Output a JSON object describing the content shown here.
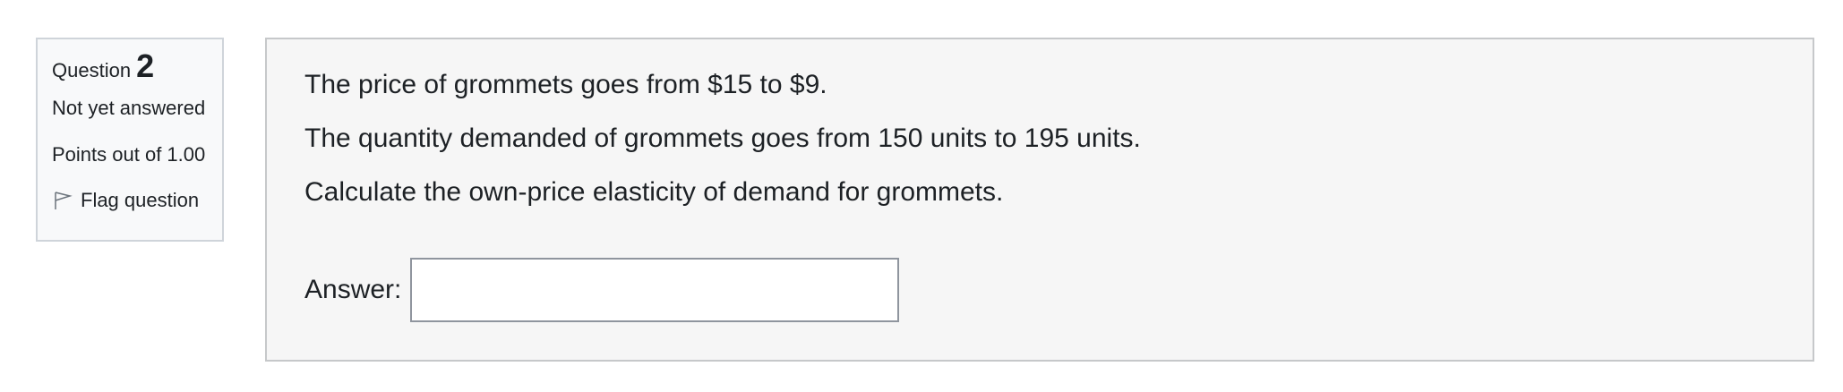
{
  "question_info": {
    "question_label": "Question",
    "question_number": "2",
    "state": "Not yet answered",
    "grade": "Points out of 1.00",
    "flag_label": "Flag question",
    "flag_icon": "flag-outline-icon"
  },
  "question": {
    "lines": [
      "The price of grommets goes from $15 to $9.",
      "The quantity demanded of grommets goes from 150 units to 195 units.",
      "Calculate the own-price elasticity of demand for grommets."
    ],
    "answer_label": "Answer:",
    "answer_value": ""
  },
  "colors": {
    "info_background": "#f8f9fa",
    "content_background": "#f6f6f6",
    "border": "#cfd4da",
    "text": "#1d2125"
  }
}
